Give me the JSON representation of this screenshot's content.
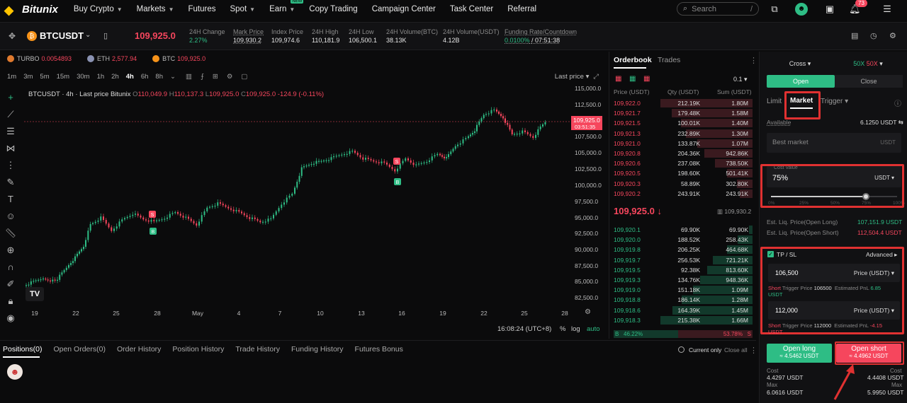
{
  "nav": {
    "brand": "Bitunix",
    "items": [
      {
        "label": "Buy Crypto",
        "caret": true
      },
      {
        "label": "Markets",
        "caret": true
      },
      {
        "label": "Futures",
        "caret": false
      },
      {
        "label": "Spot",
        "caret": true
      },
      {
        "label": "Earn",
        "caret": true,
        "badge": "NEW"
      },
      {
        "label": "Copy Trading",
        "caret": false
      },
      {
        "label": "Campaign Center",
        "caret": false
      },
      {
        "label": "Task Center",
        "caret": false
      },
      {
        "label": "Referral",
        "caret": false
      }
    ],
    "search_placeholder": "Search",
    "search_hint": "/",
    "notif_count": "73"
  },
  "ticker": {
    "symbol": "BTCUSDT",
    "last_price": "109,925.0",
    "stats": [
      {
        "label": "24H Change",
        "value": "2.27%",
        "color": "#2ebd85"
      },
      {
        "label": "Mark Price",
        "value": "109,930.2"
      },
      {
        "label": "Index Price",
        "value": "109,974.6"
      },
      {
        "label": "24H High",
        "value": "110,181.9"
      },
      {
        "label": "24H Low",
        "value": "106,500.1"
      },
      {
        "label": "24H Volume(BTC)",
        "value": "38.13K"
      },
      {
        "label": "24H Volume(USDT)",
        "value": "4.12B"
      },
      {
        "label": "Funding Rate/Countdown",
        "value": "0.0100%",
        "value2": "/ 07:51:38"
      }
    ]
  },
  "favorites": [
    {
      "name": "TURBO",
      "price": "0.0054893",
      "color": "#e07a2e"
    },
    {
      "name": "ETH",
      "price": "2,577.94",
      "color": "#8a92b2"
    },
    {
      "name": "BTC",
      "price": "109,925.0",
      "color": "#f7931a"
    }
  ],
  "chart": {
    "timeframes": [
      "1m",
      "3m",
      "5m",
      "15m",
      "30m",
      "1h",
      "2h",
      "4h",
      "6h",
      "8h"
    ],
    "active_timeframe": "4h",
    "price_type": "Last price",
    "legend_title": "BTCUSDT · 4h · Last price Bitunix",
    "ohlc": {
      "o": "110,049.9",
      "h": "110,137.3",
      "l": "109,925.0",
      "c": "109,925.0",
      "chg": "-124.9 (-0.11%)"
    },
    "price_ticks": [
      "115,000.0",
      "112,500.0",
      "107,500.0",
      "105,000.0",
      "102,500.0",
      "100,000.0",
      "97,500.0",
      "95,000.0",
      "92,500.0",
      "90,000.0",
      "87,500.0",
      "85,000.0",
      "82,500.0"
    ],
    "current_price": "109,925.0",
    "countdown": "03:51:35",
    "date_ticks": [
      "19",
      "22",
      "25",
      "28",
      "May",
      "4",
      "7",
      "10",
      "13",
      "16",
      "19",
      "22",
      "25",
      "28"
    ],
    "clock": "16:08:24 (UTC+8)",
    "percent": "%",
    "log": "log",
    "auto": "auto",
    "markers": [
      {
        "t": "S"
      },
      {
        "t": "B"
      },
      {
        "t": "S"
      },
      {
        "t": "B"
      }
    ]
  },
  "orderbook": {
    "tabs": [
      "Orderbook",
      "Trades"
    ],
    "precision": "0.1",
    "headers": [
      "Price (USDT)",
      "Qty (USDT)",
      "Sum (USDT)"
    ],
    "asks": [
      [
        "109,922.0",
        "212.19K",
        "1.80M",
        1.0
      ],
      [
        "109,921.7",
        "179.48K",
        "1.58M",
        0.88
      ],
      [
        "109,921.5",
        "100.01K",
        "1.40M",
        0.78
      ],
      [
        "109,921.3",
        "232.89K",
        "1.30M",
        0.72
      ],
      [
        "109,921.0",
        "133.87K",
        "1.07M",
        0.6
      ],
      [
        "109,920.8",
        "204.36K",
        "942.86K",
        0.52
      ],
      [
        "109,920.6",
        "237.08K",
        "738.50K",
        0.41
      ],
      [
        "109,920.5",
        "198.60K",
        "501.41K",
        0.28
      ],
      [
        "109,920.3",
        "58.89K",
        "302.80K",
        0.17
      ],
      [
        "109,920.2",
        "243.91K",
        "243.91K",
        0.14
      ]
    ],
    "mid_price": "109,925.0",
    "mid_mark": "109,930.2",
    "bids": [
      [
        "109,920.1",
        "69.90K",
        "69.90K",
        0.04
      ],
      [
        "109,920.0",
        "188.52K",
        "258.43K",
        0.16
      ],
      [
        "109,919.8",
        "206.25K",
        "464.68K",
        0.28
      ],
      [
        "109,919.7",
        "256.53K",
        "721.21K",
        0.43
      ],
      [
        "109,919.5",
        "92.38K",
        "813.60K",
        0.49
      ],
      [
        "109,919.3",
        "134.76K",
        "948.36K",
        0.57
      ],
      [
        "109,919.0",
        "151.18K",
        "1.09M",
        0.65
      ],
      [
        "109,918.8",
        "186.14K",
        "1.28M",
        0.77
      ],
      [
        "109,918.6",
        "164.39K",
        "1.45M",
        0.87
      ],
      [
        "109,918.3",
        "215.38K",
        "1.66M",
        1.0
      ]
    ],
    "buy_pct": "46.22%",
    "sell_pct": "53.78%",
    "buy_label": "B",
    "sell_label": "S"
  },
  "panel": {
    "margin_mode": "Cross",
    "leverage_long": "50X",
    "leverage_short": "50X",
    "open": "Open",
    "close": "Close",
    "order_types": [
      "Limit",
      "Market",
      "Trigger"
    ],
    "available_label": "Available",
    "available": "6.1250 USDT",
    "best_market": "Best market",
    "best_unit": "USDT",
    "cost_label": "Cost Value",
    "cost_value": "75%",
    "cost_unit": "USDT",
    "slider_pct": 0.75,
    "slider_labels": [
      "0%",
      "25%",
      "50%",
      "75%",
      "100%"
    ],
    "liq_long_label": "Est. Liq. Price(Open Long)",
    "liq_long": "107,151.9 USDT",
    "liq_short_label": "Est. Liq. Price(Open Short)",
    "liq_short": "112,504.4 USDT",
    "tpsl_label": "TP / SL",
    "advanced": "Advanced",
    "tp_value": "106,500",
    "tp_type": "Price (USDT)",
    "tp_note": {
      "side": "Short",
      "label": "Trigger Price",
      "price": "106500",
      "pnl_label": "Estimated PnL",
      "pnl": "6.85",
      "unit": "USDT"
    },
    "sl_value": "112,000",
    "sl_type": "Price (USDT)",
    "sl_note": {
      "side": "Short",
      "label": "Trigger Price",
      "price": "112000",
      "pnl_label": "Estimated PnL",
      "pnl": "-4.15",
      "unit": "USDT"
    },
    "long_btn": "Open long",
    "long_sub": "≈ 4.5462 USDT",
    "short_btn": "Open short",
    "short_sub": "≈ 4.4962 USDT",
    "cost_l_label": "Cost",
    "cost_l": "4.4297 USDT",
    "max_l_label": "Max",
    "max_l": "6.0616 USDT",
    "cost_s_label": "Cost",
    "cost_s": "4.4408 USDT",
    "max_s_label": "Max",
    "max_s": "5.9950 USDT"
  },
  "bottom": {
    "tabs": [
      "Positions(0)",
      "Open Orders(0)",
      "Order History",
      "Position History",
      "Trade History",
      "Funding History",
      "Futures Bonus"
    ],
    "current_only": "Current only",
    "close_all": "Close all"
  }
}
